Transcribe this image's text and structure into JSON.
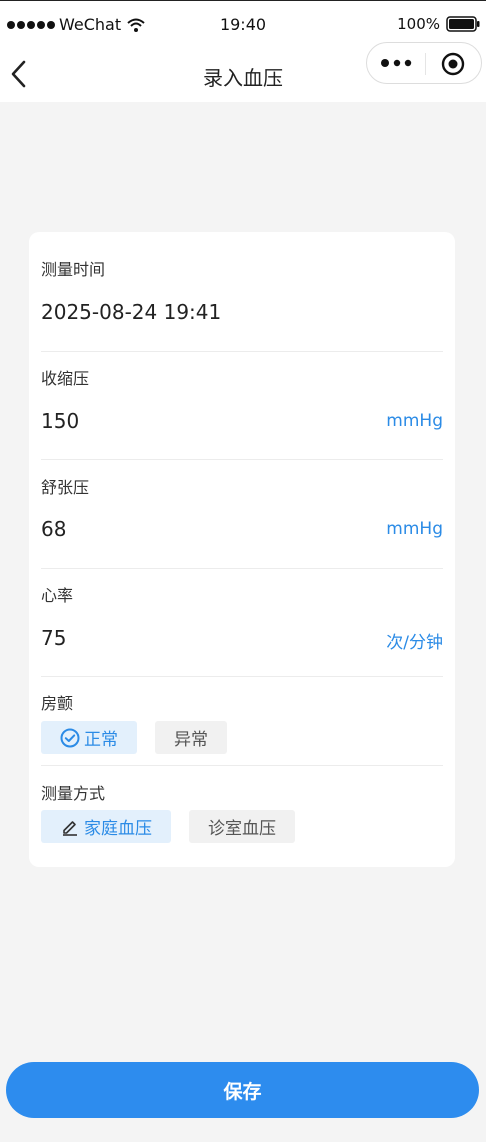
{
  "status_bar": {
    "carrier": "WeChat",
    "time": "19:40",
    "battery": "100%"
  },
  "nav": {
    "title": "录入血压"
  },
  "form": {
    "measure_time": {
      "label": "测量时间",
      "value": "2025-08-24 19:41"
    },
    "systolic": {
      "label": "收缩压",
      "value": "150",
      "unit": "mmHg"
    },
    "diastolic": {
      "label": "舒张压",
      "value": "68",
      "unit": "mmHg"
    },
    "heart_rate": {
      "label": "心率",
      "value": "75",
      "unit": "次/分钟"
    },
    "af": {
      "label": "房颤",
      "options": [
        "正常",
        "异常"
      ],
      "selected": "正常"
    },
    "method": {
      "label": "测量方式",
      "options": [
        "家庭血压",
        "诊室血压"
      ],
      "selected": "家庭血压"
    }
  },
  "actions": {
    "save_label": "保存"
  },
  "colors": {
    "accent": "#2d8cee",
    "background": "#f4f4f4"
  }
}
